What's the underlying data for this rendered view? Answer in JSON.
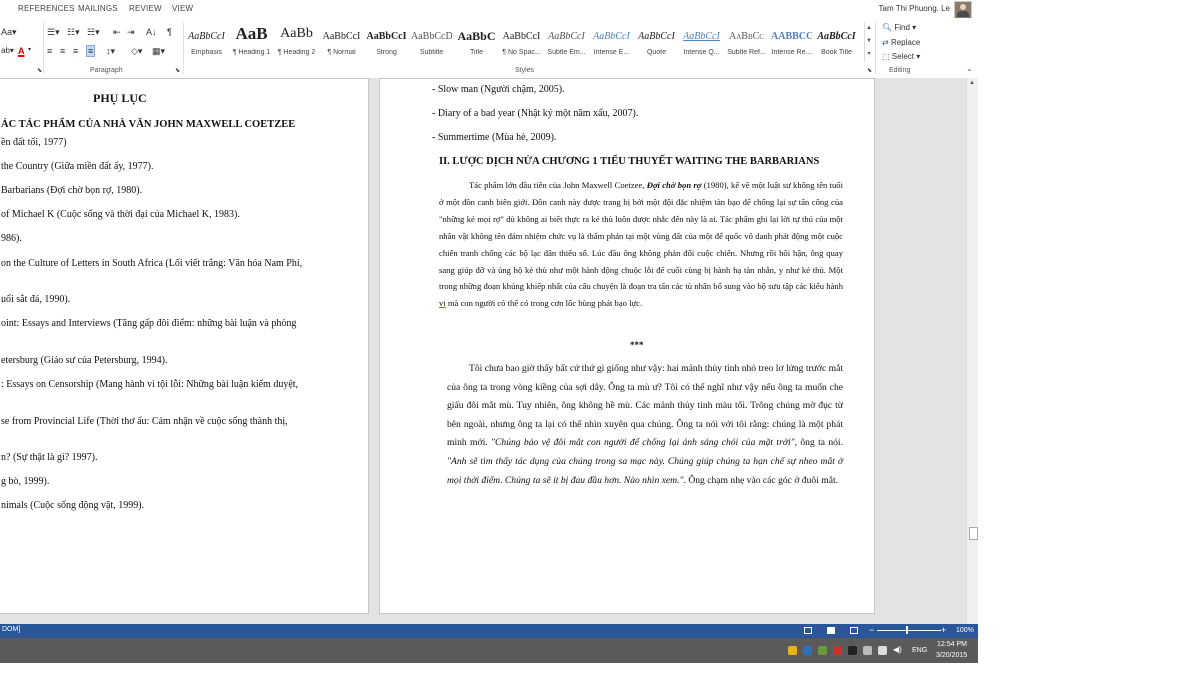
{
  "ribbon": {
    "tabs": [
      "REFERENCES",
      "MAILINGS",
      "REVIEW",
      "VIEW"
    ],
    "user_name": "Tam Thi Phuong. Le",
    "groups": {
      "paragraph": "Paragraph",
      "styles": "Styles",
      "editing": "Editing"
    },
    "styles": [
      {
        "sample": "AaBbCcI",
        "name": "Emphasis"
      },
      {
        "sample": "AaB",
        "name": "¶ Heading 1"
      },
      {
        "sample": "AaBb",
        "name": "¶ Heading 2"
      },
      {
        "sample": "AaBbCcI",
        "name": "¶ Normal"
      },
      {
        "sample": "AaBbCcI",
        "name": "Strong"
      },
      {
        "sample": "AaBbCcD",
        "name": "Subtitle"
      },
      {
        "sample": "AaBbC",
        "name": "Title"
      },
      {
        "sample": "AaBbCcI",
        "name": "¶ No Spac..."
      },
      {
        "sample": "AaBbCcI",
        "name": "Subtle Em..."
      },
      {
        "sample": "AaBbCcI",
        "name": "Intense E..."
      },
      {
        "sample": "AaBbCcI",
        "name": "Quote"
      },
      {
        "sample": "AaBbCcI",
        "name": "Intense Q..."
      },
      {
        "sample": "AaBbCc",
        "name": "Subtle Ref..."
      },
      {
        "sample": "AABBCC",
        "name": "Intense Re..."
      },
      {
        "sample": "AaBbCcI",
        "name": "Book Title"
      }
    ],
    "editing": {
      "find": "Find",
      "replace": "Replace",
      "select": "Select"
    }
  },
  "left_page": {
    "title": "PHỤ LỤC",
    "heading": "ÁC TÁC PHẨM CỦA NHÀ VĂN JOHN MAXWELL COETZEE",
    "lines": [
      "ền đất tối, 1977)",
      "the Country (Giữa miền đất ấy, 1977).",
      "Barbarians (Đợi chờ bọn rợ, 1980).",
      "of Michael K (Cuộc sống và thời đại của Michael K, 1983).",
      "986).",
      "on the Culture of Letters in South Africa (Lối viết trắng: Văn hóa Nam Phi,",
      "uổi sắt đá, 1990).",
      "oint: Essays and Interviews (Tăng gấp đôi điểm: những bài luận và phỏng",
      "etersburg (Giáo sư của Petersburg, 1994).",
      ": Essays on Censorship (Mang hành vi tội lỗi: Những bài luận kiểm duyệt,",
      "se from Provincial Life (Thời thơ ấu: Cảm nhận về cuộc sống thành thị,",
      "n? (Sự thật là gì? 1997).",
      "g bò, 1999).",
      "nimals (Cuộc sống động vật, 1999)."
    ]
  },
  "right_page": {
    "lines": [
      "- Slow man (Người chậm, 2005).",
      "- Diary of a bad year (Nhật ký một năm xấu, 2007).",
      "- Summertime (Mùa hè, 2009)."
    ],
    "heading": "II. LƯỢC DỊCH NỬA CHƯƠNG 1 TIỂU THUYẾT WAITING THE BARBARIANS",
    "p1_a": "Tác phẩm lớn đầu tiên của John Maxwell Coetzee, ",
    "p1_b": "Đợi chờ bọn rợ",
    "p1_c": " (1980), kể về một luật sư không tên tuổi ở một đồn canh biên giới. Đồn canh này được trang bị bởi một đội đặc nhiệm tàn bạo để chống lại sự tấn công của \"những kẻ mọi rợ\" dù không ai biết thực ra kẻ thù luôn được nhắc đến này là ai. Tác phẩm ghi lại lời tự thú của một nhân vật không tên đảm nhiệm chức vụ là thẩm phán tại một vùng đất của một đế quốc vô danh phát động một cuộc chiến tranh chống các bộ lạc dân thiểu số. Lúc đầu ông không phản đối cuộc chiến. Nhưng rồi hối hận, ông quay sang giúp đỡ và ủng hộ kẻ thù như một hành động chuộc lỗi để cuối cùng bị hành hạ tàn nhẫn, y như kẻ thù. Một trong những đoạn khủng khiếp nhất của câu chuyện là đoạn tra tấn các tù nhân bổ sung vào bộ sưu tập các kiểu hành ",
    "p1_d": "vi",
    "p1_e": " mà con người có thể có trong cơn lốc bùng phát bạo lực.",
    "stars": "***",
    "p2_a": "Tôi chưa bao giờ thấy bất cứ thứ gì giống như vậy: hai mảnh thủy tinh nhỏ treo lơ lửng trước mắt của ông ta trong vòng kiềng của sợi dây. Ông ta mù ư? Tôi có thể nghĩ như vậy nếu ông ta muốn che giấu đôi mắt mù. Tuy nhiên, ông không hề mù. Các mảnh thủy tinh màu tối. Trông chúng mờ đục từ bên ngoài, nhưng ông ta lại có thể nhìn xuyên qua chúng. Ông ta nói với tôi rằng: chúng là một phát minh mới. ",
    "p2_b": "\"Chúng bảo vệ đôi mắt con người để chống lại ánh sáng chói của mặt trời\"",
    "p2_c": ", ông ta nói. ",
    "p2_d": "\"Anh sẽ tìm thấy tác dụng của chúng trong sa mạc này. Chúng giúp chúng ta hạn chế sự nheo mắt ở mọi thời điểm. Chúng ta sẽ ít bị đau đầu hơn. Nào nhìn xem.\"",
    "p2_e": ". Ông chạm nhẹ vào các góc ở đuôi mắt."
  },
  "status": {
    "left_text": "DOM]",
    "zoom": "100%"
  },
  "taskbar": {
    "lang": "ENG",
    "time": "12:54 PM",
    "date": "3/20/2015"
  }
}
